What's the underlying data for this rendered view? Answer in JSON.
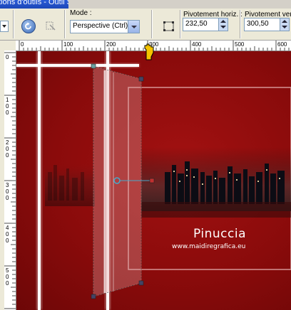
{
  "window": {
    "title": "tions d'outils - Outil Sélecteur"
  },
  "toolbar": {
    "mode_label": "Mode :",
    "mode_value": "Perspective (Ctrl)",
    "pivot_h_label": "Pivotement horiz. :",
    "pivot_h_value": "232,50",
    "pivot_v_label": "Pivotement ver",
    "pivot_v_value": "300,50"
  },
  "ruler": {
    "h_ticks": [
      "0",
      "100",
      "200",
      "300",
      "400",
      "500",
      "600"
    ],
    "v_ticks": [
      "0",
      "1\n0\n0",
      "2\n0\n0",
      "3\n0\n0",
      "4\n0\n0",
      "5\n0\n0"
    ]
  },
  "canvas": {
    "brand": "Pinuccia",
    "url": "www.maidiregrafica.eu"
  },
  "colors": {
    "background": "#8a0b0b",
    "highlight": "#ffffff",
    "toolbar": "#ece9d8"
  }
}
